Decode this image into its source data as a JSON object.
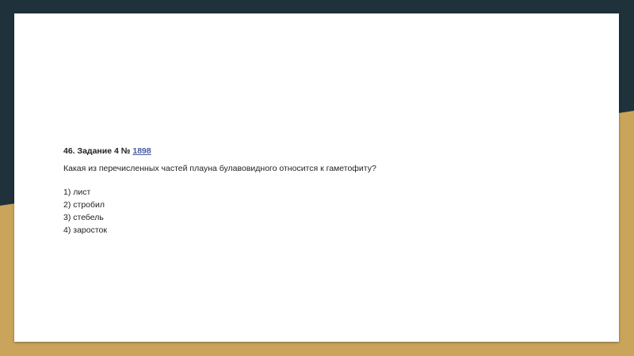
{
  "theme": {
    "dark_bg": "#1f313b",
    "gold_bg": "#c9a45a",
    "slide_bg": "#ffffff",
    "link_color": "#4a5aa0"
  },
  "task": {
    "prefix": "46. Задание 4 № ",
    "number": "1898",
    "question": "Какая из перечисленных частей плауна булавовидного относится к гаметофиту?",
    "options": [
      "1) лист",
      "2) стробил",
      "3) стебель",
      "4) заросток"
    ]
  }
}
